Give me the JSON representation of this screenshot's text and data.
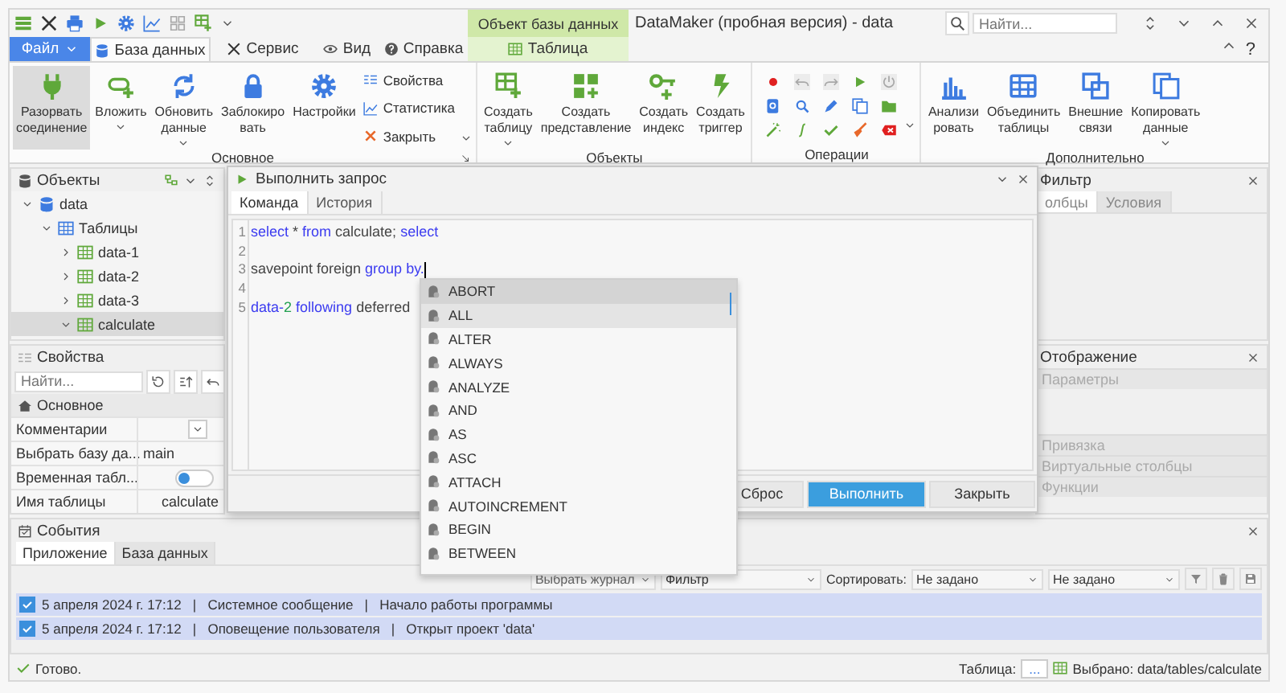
{
  "quick_access": [
    {
      "disabled": false
    },
    {
      "disabled": false
    },
    {
      "disabled": false
    },
    {
      "disabled": false
    },
    {
      "disabled": false
    },
    {
      "disabled": false
    },
    {
      "disabled": true
    },
    {
      "disabled": false
    }
  ],
  "context_group": "Объект базы данных",
  "window": {
    "title": "DataMaker (пробная версия) - data",
    "search": {
      "placeholder": "Найти..."
    },
    "help": "?"
  },
  "tabs": [
    {
      "label": "Файл",
      "kind": "file",
      "selected": false
    },
    {
      "label": "База данных",
      "kind": "normal",
      "selected": true
    },
    {
      "label": "Сервис",
      "kind": "normal",
      "selected": false
    },
    {
      "label": "Вид",
      "kind": "normal",
      "selected": false
    },
    {
      "label": "Справка",
      "kind": "normal",
      "selected": false
    },
    {
      "label": "Таблица",
      "kind": "context",
      "selected": false
    }
  ],
  "ribbon": [
    {
      "label": "Основное",
      "buttons": [
        {
          "lines": [
            "Разорвать",
            "соединение"
          ],
          "pressed": true,
          "dropdown": false
        },
        {
          "lines": [
            "Вложить"
          ],
          "pressed": false,
          "dropdown": true
        },
        {
          "lines": [
            "Обновить",
            "данные"
          ],
          "pressed": false,
          "dropdown": true
        },
        {
          "lines": [
            "Заблокиро",
            "вать"
          ],
          "pressed": false,
          "dropdown": false
        },
        {
          "lines": [
            "Настройки"
          ],
          "pressed": false,
          "dropdown": false
        }
      ],
      "small_buttons": [
        {
          "label": "Свойства"
        },
        {
          "label": "Статистика"
        },
        {
          "label": "Закрыть"
        }
      ]
    },
    {
      "label": "Объекты",
      "buttons": [
        {
          "lines": [
            "Создать",
            "таблицу"
          ],
          "pressed": false,
          "dropdown": true
        },
        {
          "lines": [
            "Создать",
            "представление"
          ],
          "pressed": false,
          "dropdown": false
        },
        {
          "lines": [
            "Создать",
            "индекс"
          ],
          "pressed": false,
          "dropdown": false
        },
        {
          "lines": [
            "Создать",
            "триггер"
          ],
          "pressed": false,
          "dropdown": false
        }
      ]
    },
    {
      "label": "Операции",
      "tools": [
        {
          "disabled": false
        },
        {
          "disabled": true
        },
        {
          "disabled": true
        },
        {
          "disabled": false
        },
        {
          "disabled": true
        },
        {
          "disabled": false
        },
        {
          "disabled": false
        },
        {
          "disabled": false
        },
        {
          "disabled": false
        },
        {
          "disabled": false
        },
        {
          "disabled": false
        },
        {
          "disabled": false
        },
        {
          "disabled": false
        },
        {
          "disabled": false
        },
        {
          "disabled": false
        }
      ]
    },
    {
      "label": "Дополнительно",
      "buttons": [
        {
          "lines": [
            "Анализи",
            "ровать"
          ],
          "pressed": false,
          "dropdown": false
        },
        {
          "lines": [
            "Объединить",
            "таблицы"
          ],
          "pressed": false,
          "dropdown": false
        },
        {
          "lines": [
            "Внешние",
            "связи"
          ],
          "pressed": false,
          "dropdown": false
        },
        {
          "lines": [
            "Копировать",
            "данные"
          ],
          "pressed": false,
          "dropdown": true
        }
      ]
    }
  ],
  "objects_panel": {
    "title": "Объекты",
    "tree": [
      {
        "label": "data",
        "expanded": true,
        "selected": false,
        "children": [
          {
            "label": "Таблицы",
            "expanded": true,
            "selected": false,
            "children": [
              {
                "label": "data-1",
                "expanded": false,
                "selected": false
              },
              {
                "label": "data-2",
                "expanded": false,
                "selected": false
              },
              {
                "label": "data-3",
                "expanded": false,
                "selected": false
              },
              {
                "label": "calculate",
                "expanded": true,
                "selected": true
              }
            ]
          }
        ]
      }
    ]
  },
  "properties_panel": {
    "title": "Свойства",
    "search": {
      "placeholder": "Найти..."
    },
    "section": "Основное",
    "rows": [
      {
        "name": "Комментарии",
        "kind": "dropdown"
      },
      {
        "name": "Выбрать базу да...",
        "kind": "text",
        "value": "main"
      },
      {
        "name": "Временная табл...",
        "kind": "toggle",
        "on": false
      },
      {
        "name": "Имя таблицы",
        "kind": "text",
        "value": "calculate"
      }
    ]
  },
  "query_dialog": {
    "title": "Выполнить запрос",
    "tabs": [
      {
        "label": "Команда",
        "selected": true
      },
      {
        "label": "История",
        "selected": false
      }
    ],
    "lines": [
      {
        "number": "1",
        "tokens": [
          {
            "text": "select",
            "kind": "keyword"
          },
          {
            "text": " * ",
            "kind": "plain"
          },
          {
            "text": "from",
            "kind": "keyword"
          },
          {
            "text": " calculate; ",
            "kind": "plain"
          },
          {
            "text": "select",
            "kind": "keyword"
          }
        ]
      },
      {
        "number": "2"
      },
      {
        "number": "3",
        "tokens": [
          {
            "text": "savepoint foreign ",
            "kind": "plain"
          },
          {
            "text": "group by.",
            "kind": "keyword"
          }
        ]
      },
      {
        "number": "4"
      },
      {
        "number": "5",
        "tokens": [
          {
            "text": "data-",
            "kind": "keyword"
          },
          {
            "text": "2",
            "kind": "number"
          },
          {
            "text": " following",
            "kind": "keyword"
          },
          {
            "text": " deferred",
            "kind": "plain"
          }
        ]
      }
    ],
    "buttons": [
      {
        "label": "Сброс",
        "kind": "normal"
      },
      {
        "label": "Выполнить",
        "kind": "primary"
      },
      {
        "label": "Закрыть",
        "kind": "normal"
      }
    ]
  },
  "autocomplete": {
    "items": [
      {
        "label": "ABORT",
        "selected": true,
        "highlighted": false
      },
      {
        "label": "ALL",
        "selected": false,
        "highlighted": true
      },
      {
        "label": "ALTER",
        "selected": false,
        "highlighted": false
      },
      {
        "label": "ALWAYS",
        "selected": false,
        "highlighted": false
      },
      {
        "label": "ANALYZE",
        "selected": false,
        "highlighted": false
      },
      {
        "label": "AND",
        "selected": false,
        "highlighted": false
      },
      {
        "label": "AS",
        "selected": false,
        "highlighted": false
      },
      {
        "label": "ASC",
        "selected": false,
        "highlighted": false
      },
      {
        "label": "ATTACH",
        "selected": false,
        "highlighted": false
      },
      {
        "label": "AUTOINCREMENT",
        "selected": false,
        "highlighted": false
      },
      {
        "label": "BEGIN",
        "selected": false,
        "highlighted": false
      },
      {
        "label": "BETWEEN",
        "selected": false,
        "highlighted": false
      }
    ]
  },
  "filter_panel": {
    "title": "Фильтр",
    "tabs": [
      {
        "label": "олбцы",
        "selected": true
      },
      {
        "label": "Условия",
        "selected": false
      }
    ]
  },
  "display_panel": {
    "title": "Отображение",
    "sections": [
      {
        "label": "Параметры",
        "expanded": true,
        "disabled": true
      },
      {
        "label": "Привязка",
        "expanded": false,
        "disabled": true
      },
      {
        "label": "Виртуальные столбцы",
        "expanded": false,
        "disabled": true
      },
      {
        "label": "Функции",
        "expanded": false,
        "disabled": true
      }
    ]
  },
  "events_panel": {
    "title": "События",
    "tabs": [
      {
        "label": "Приложение",
        "selected": true
      },
      {
        "label": "База данных",
        "selected": false
      }
    ],
    "journal": {
      "placeholder": "Выбрать журнал"
    },
    "filter": {
      "placeholder": "Фильтр"
    },
    "sort_label": "Сортировать:",
    "sort_field": "Не задано",
    "sort_order": "Не задано",
    "rows": [
      {
        "checked": true,
        "text": "5 апреля 2024 г. 17:12   |   Системное сообщение   |   Начало работы программы"
      },
      {
        "checked": true,
        "text": "5 апреля 2024 г. 17:12   |   Оповещение пользователя   |   Открыт проект 'data'"
      }
    ]
  },
  "status_bar": {
    "message": "Готово.",
    "table_label": "Таблица:",
    "table_value": "...",
    "selection": "Выбрано: data/tables/calculate"
  }
}
